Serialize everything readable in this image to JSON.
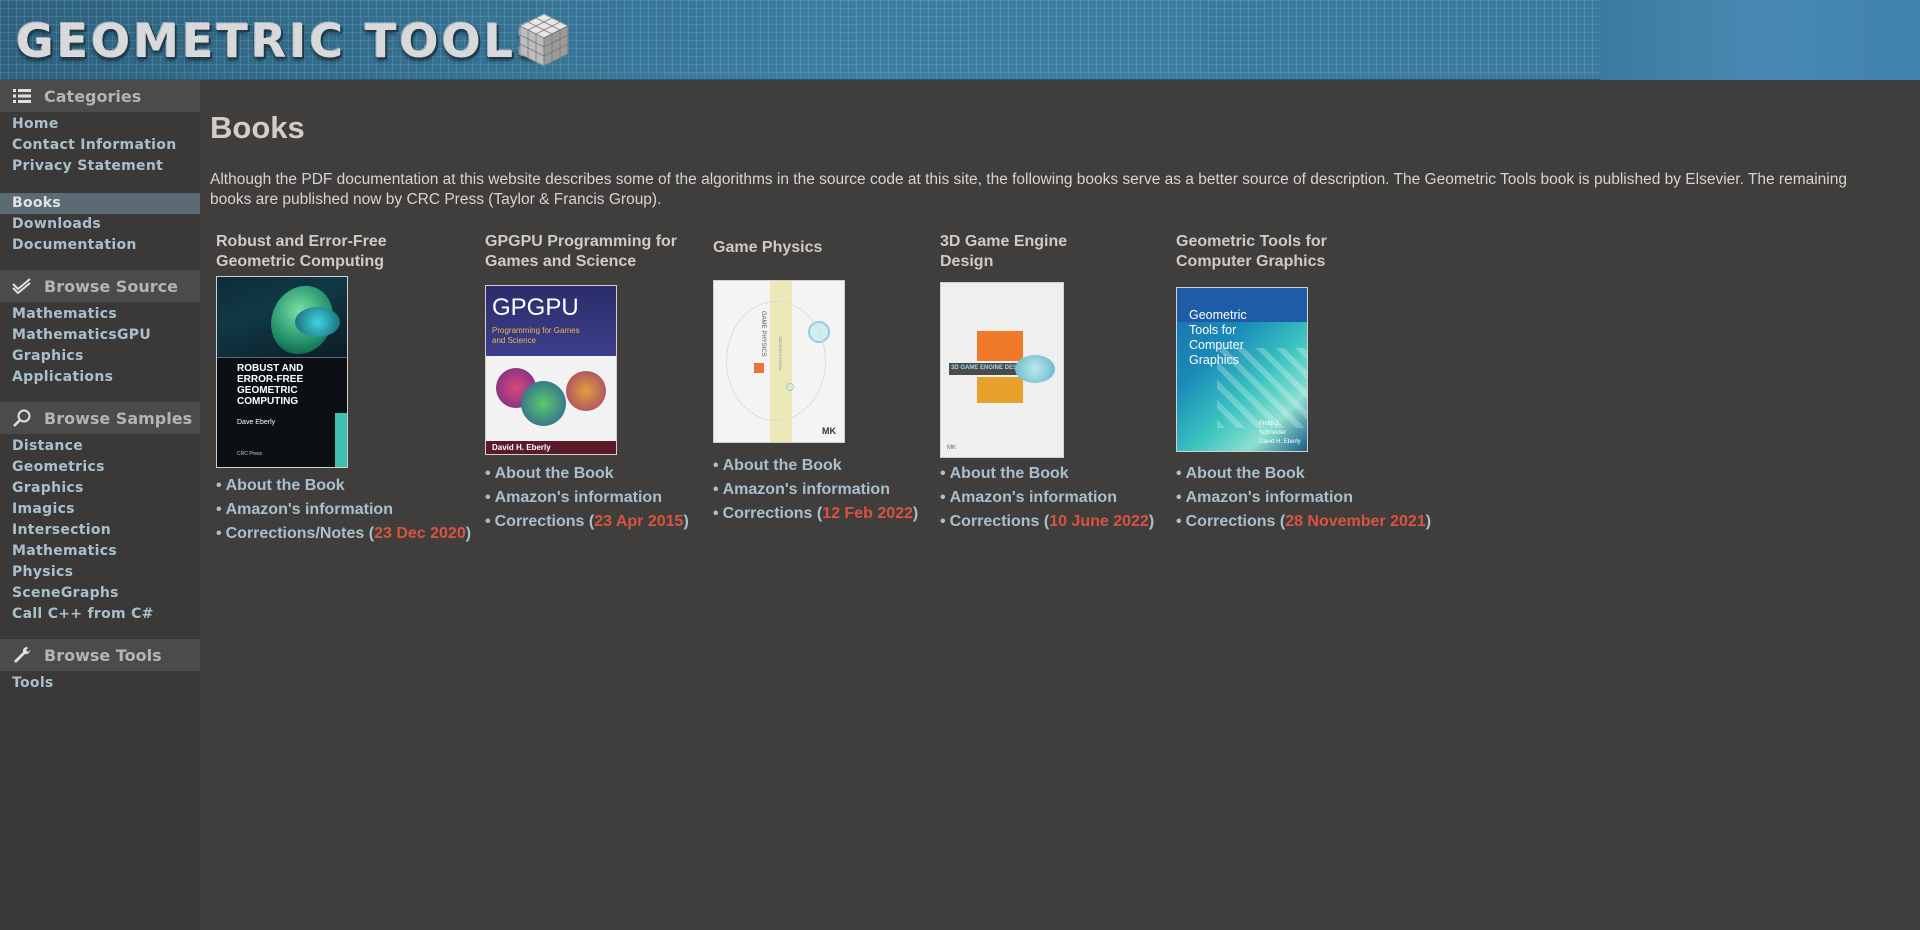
{
  "header": {
    "logo_text": "GEOMETRIC TOOLS"
  },
  "sidebar": {
    "sections": [
      {
        "title": "Categories",
        "icon": "list-icon",
        "items": [
          "Home",
          "Contact Information",
          "Privacy Statement"
        ]
      },
      {
        "title": "",
        "icon": "",
        "items": [
          "Books",
          "Downloads",
          "Documentation"
        ]
      },
      {
        "title": "Browse Source",
        "icon": "checkmarks-icon",
        "items": [
          "Mathematics",
          "MathematicsGPU",
          "Graphics",
          "Applications"
        ]
      },
      {
        "title": "Browse Samples",
        "icon": "magnifier-icon",
        "items": [
          "Distance",
          "Geometrics",
          "Graphics",
          "Imagics",
          "Intersection",
          "Mathematics",
          "Physics",
          "SceneGraphs",
          "Call C++ from C#"
        ]
      },
      {
        "title": "Browse Tools",
        "icon": "wrench-icon",
        "items": [
          "Tools"
        ]
      }
    ],
    "active_item": "Books"
  },
  "main": {
    "title": "Books",
    "intro": "Although the PDF documentation at this website describes some of the algorithms in the source code at this site, the following books serve as a better source of description. The Geometric Tools book is published by Elsevier. The remaining books are published now by CRC Press (Taylor & Francis Group).",
    "books": [
      {
        "title_line1": "Robust and Error-Free",
        "title_line2": "Geometric Computing",
        "link1": "About the Book",
        "link2": "Amazon's information",
        "link3": "Corrections/Notes",
        "date": "23 Dec 2020",
        "cover_text1": "ROBUST AND",
        "cover_text2": "ERROR-FREE",
        "cover_text3": "GEOMETRIC",
        "cover_text4": "COMPUTING",
        "cover_author": "Dave Eberly",
        "cover_publisher": "CRC Press"
      },
      {
        "title_line1": "GPGPU Programming for",
        "title_line2": "Games and Science",
        "link1": "About the Book",
        "link2": "Amazon's information",
        "link3": "Corrections",
        "date": "23 Apr 2015",
        "cover_text1": "GPGPU",
        "cover_text2": "Programming for Games",
        "cover_text3": "and Science",
        "cover_author": "David H. Eberly"
      },
      {
        "title_line1": "Game Physics",
        "title_line2": "",
        "link1": "About the Book",
        "link2": "Amazon's information",
        "link3": "Corrections",
        "date": "12 Feb 2022",
        "cover_text1": "GAME PHYSICS",
        "cover_text2": "SECOND EDITION",
        "cover_publisher": "MK"
      },
      {
        "title_line1": "3D Game Engine",
        "title_line2": "Design",
        "link1": "About the Book",
        "link2": "Amazon's information",
        "link3": "Corrections",
        "date": "10 June 2022",
        "cover_text1": "3D GAME ENGINE DESIGN",
        "cover_publisher": "MK"
      },
      {
        "title_line1": "Geometric Tools for",
        "title_line2": "Computer Graphics",
        "link1": "About the Book",
        "link2": "Amazon's information",
        "link3": "Corrections",
        "date": "28 November 2021",
        "cover_text1": "Geometric",
        "cover_text2": "Tools for",
        "cover_text3": "Computer",
        "cover_text4": "Graphics",
        "cover_author": "Philip J. Schneider",
        "cover_author2": "David H. Eberly"
      }
    ]
  },
  "colors": {
    "background": "#403e3d",
    "sidebar_link": "#a9c0cc",
    "date": "#d9543f",
    "active_bg": "#5a6b74"
  }
}
